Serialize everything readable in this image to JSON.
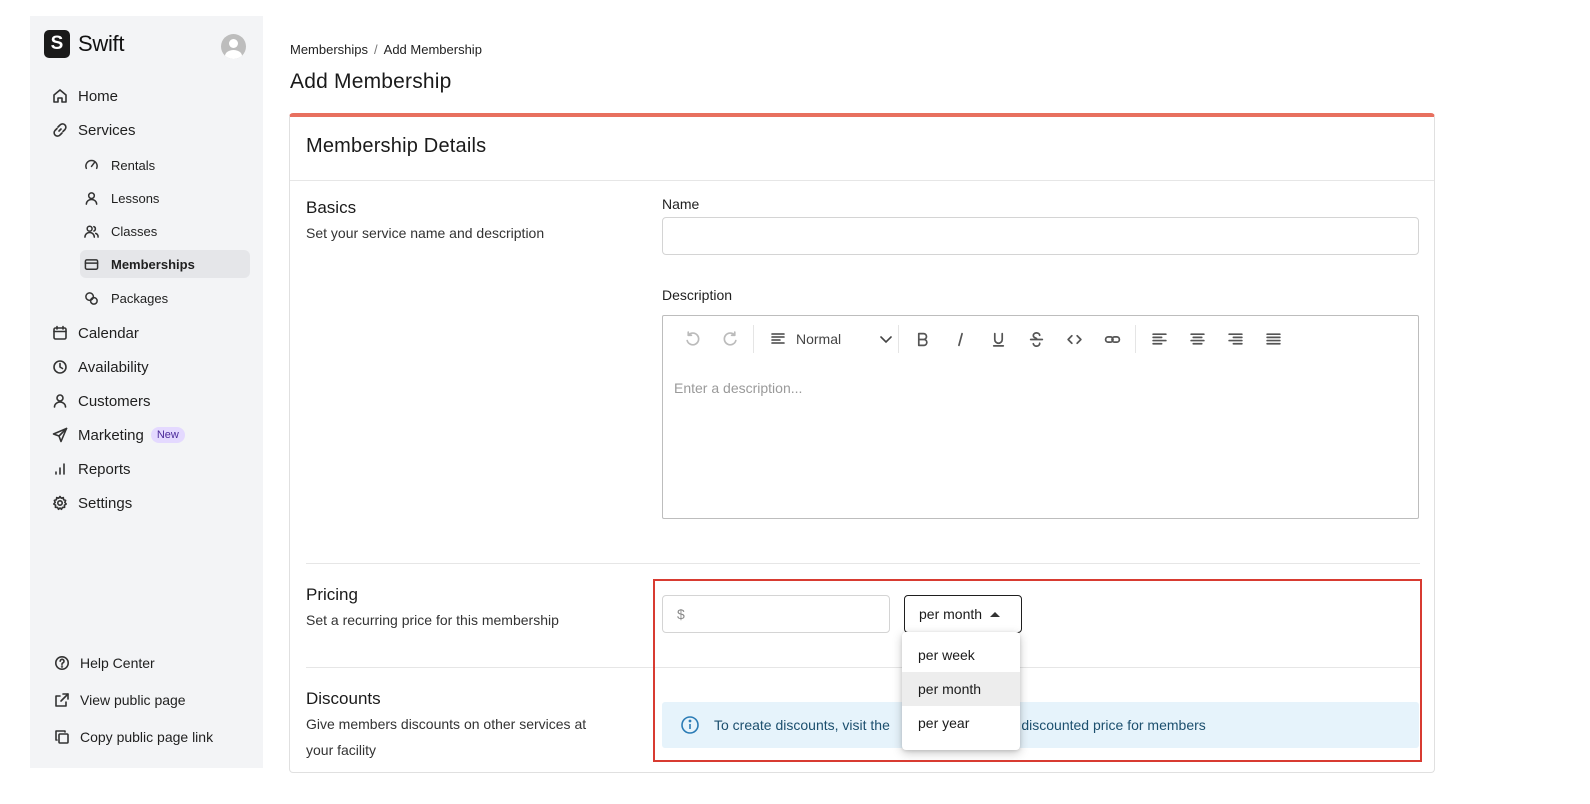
{
  "app": {
    "brand_letter": "S",
    "brand_name": "Swift"
  },
  "sidebar": {
    "items": [
      {
        "label": "Home",
        "icon": "home-icon"
      },
      {
        "label": "Services",
        "icon": "link-icon"
      },
      {
        "label": "Rentals",
        "icon": "gauge-icon"
      },
      {
        "label": "Lessons",
        "icon": "person-icon"
      },
      {
        "label": "Classes",
        "icon": "people-icon"
      },
      {
        "label": "Memberships",
        "icon": "card-icon",
        "active": true
      },
      {
        "label": "Packages",
        "icon": "package-icon"
      },
      {
        "label": "Calendar",
        "icon": "calendar-icon"
      },
      {
        "label": "Availability",
        "icon": "clock-icon"
      },
      {
        "label": "Customers",
        "icon": "person-icon"
      },
      {
        "label": "Marketing",
        "icon": "send-icon",
        "badge": "New"
      },
      {
        "label": "Reports",
        "icon": "bar-chart-icon"
      },
      {
        "label": "Settings",
        "icon": "gear-icon"
      }
    ],
    "footer": [
      {
        "label": "Help Center",
        "icon": "help-icon"
      },
      {
        "label": "View public page",
        "icon": "external-link-icon"
      },
      {
        "label": "Copy public page link",
        "icon": "copy-icon"
      }
    ]
  },
  "breadcrumb": {
    "parent": "Memberships",
    "separator": "/",
    "current": "Add Membership"
  },
  "page": {
    "title": "Add Membership"
  },
  "card": {
    "title": "Membership Details"
  },
  "basics": {
    "title": "Basics",
    "description": "Set your service name and description",
    "name_label": "Name",
    "name_value": "",
    "description_label": "Description",
    "description_placeholder": "Enter a description..."
  },
  "editor_toolbar": {
    "block_type": "Normal"
  },
  "pricing": {
    "title": "Pricing",
    "description": "Set a recurring price for this membership",
    "currency_symbol": "$",
    "price_value": "",
    "period_selected": "per month",
    "period_options": [
      "per week",
      "per month",
      "per year"
    ]
  },
  "discounts": {
    "title": "Discounts",
    "description": "Give members discounts on other services at your facility",
    "info_text": "To create discounts, visit the                    nd set a discounted price for members"
  },
  "colors": {
    "accent_bar": "#e8705f",
    "highlight_box": "#d83b31",
    "info_bg": "#e6f3fb",
    "badge_bg": "#e4d9ff"
  }
}
